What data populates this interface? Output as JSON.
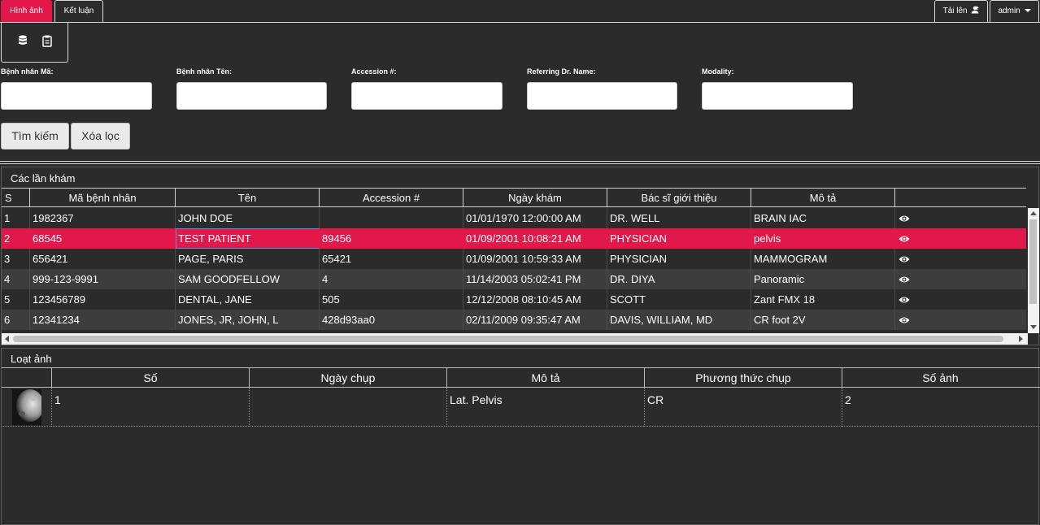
{
  "nav": {
    "tabs": [
      {
        "label": "Hình ảnh"
      },
      {
        "label": "Kết luận"
      }
    ],
    "upload_label": "Tải lên",
    "user_label": "admin"
  },
  "filters": {
    "patient_id_label": "Bệnh nhân Mã:",
    "patient_name_label": "Bệnh nhân Tên:",
    "accession_label": "Accession #:",
    "referring_label": "Referring Dr. Name:",
    "modality_label": "Modality:",
    "search_button": "Tìm kiếm",
    "clear_button": "Xóa lọc"
  },
  "studies": {
    "title": "Các lần khám",
    "columns": [
      "S",
      "Mã bệnh nhân",
      "Tên",
      "Accession #",
      "Ngày khám",
      "Bác sĩ giới thiệu",
      "Mô tả",
      ""
    ],
    "rows": [
      {
        "no": "1",
        "patient_id": "1982367",
        "name": "JOHN DOE",
        "accession": "",
        "date": "01/01/1970 12:00:00 AM",
        "doctor": "DR. WELL",
        "description": "BRAIN IAC"
      },
      {
        "no": "2",
        "patient_id": "68545",
        "name": "TEST PATIENT",
        "accession": "89456",
        "date": "01/09/2001 10:08:21 AM",
        "doctor": "PHYSICIAN",
        "description": "pelvis"
      },
      {
        "no": "3",
        "patient_id": "656421",
        "name": "PAGE, PARIS",
        "accession": "65421",
        "date": "01/09/2001 10:59:33 AM",
        "doctor": "PHYSICIAN",
        "description": "MAMMOGRAM"
      },
      {
        "no": "4",
        "patient_id": "999-123-9991",
        "name": "SAM GOODFELLOW",
        "accession": "4",
        "date": "11/14/2003 05:02:41 PM",
        "doctor": "DR. DIYA",
        "description": "Panoramic"
      },
      {
        "no": "5",
        "patient_id": "123456789",
        "name": "DENTAL, JANE",
        "accession": "505",
        "date": "12/12/2008 08:10:45 AM",
        "doctor": "SCOTT",
        "description": "Zant FMX 18"
      },
      {
        "no": "6",
        "patient_id": "12341234",
        "name": "JONES, JR, JOHN, L",
        "accession": "428d93aa0",
        "date": "02/11/2009 09:35:47 AM",
        "doctor": "DAVIS, WILLIAM, MD",
        "description": "CR foot 2V"
      }
    ],
    "selected_row": 2
  },
  "series": {
    "title": "Loạt ảnh",
    "columns": [
      "Số",
      "Ngày chụp",
      "Mô tả",
      "Phương thức chụp",
      "Số ảnh"
    ],
    "rows": [
      {
        "number": "1",
        "date": "",
        "description": "Lat. Pelvis",
        "modality": "CR",
        "images": "2"
      }
    ]
  },
  "colors": {
    "accent": "#e3184a",
    "background": "#2b2b2b",
    "alt_row": "#3d3d3d"
  }
}
